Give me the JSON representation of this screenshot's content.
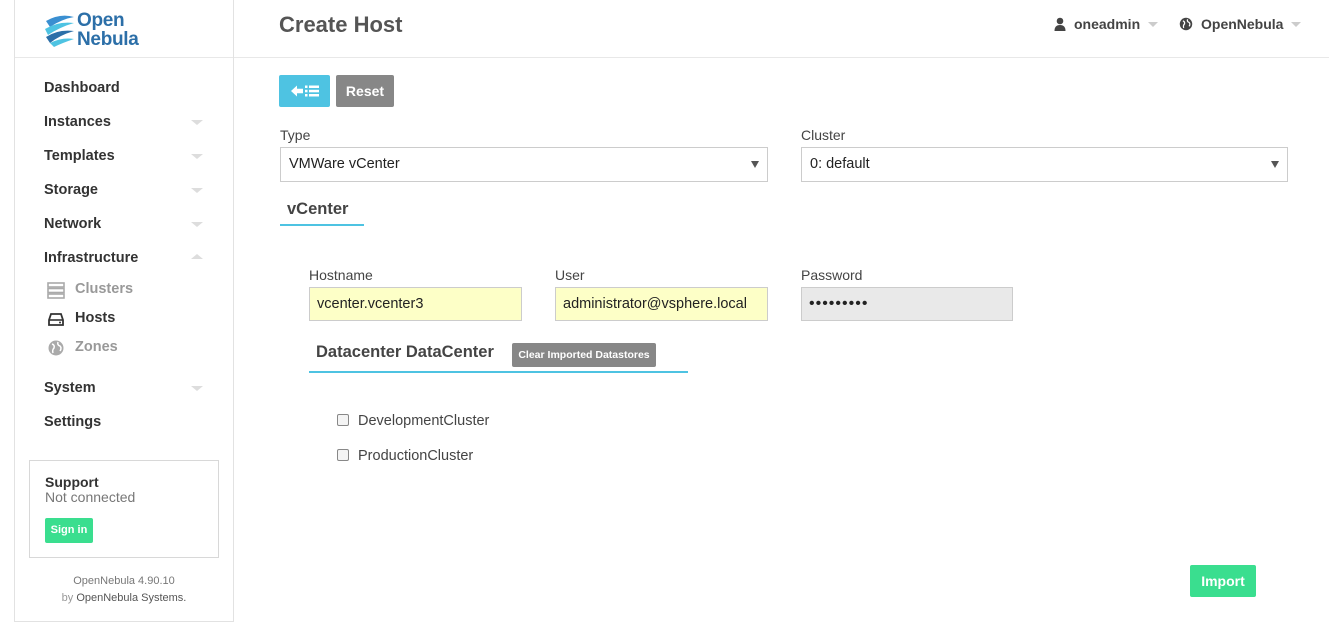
{
  "app": {
    "logo_line1": "Open",
    "logo_line2": "Nebula"
  },
  "sidebar": {
    "items": [
      {
        "label": "Dashboard"
      },
      {
        "label": "Instances"
      },
      {
        "label": "Templates"
      },
      {
        "label": "Storage"
      },
      {
        "label": "Network"
      },
      {
        "label": "Infrastructure"
      },
      {
        "label": "System"
      },
      {
        "label": "Settings"
      }
    ],
    "infrastructure_sub": [
      {
        "label": "Clusters",
        "icon": "server-icon"
      },
      {
        "label": "Hosts",
        "icon": "hdd-icon"
      },
      {
        "label": "Zones",
        "icon": "globe-icon"
      }
    ],
    "support": {
      "title": "Support",
      "status": "Not connected",
      "signin_label": "Sign in"
    },
    "footer": {
      "version": "OpenNebula 4.90.10",
      "by": "by",
      "company": "OpenNebula Systems."
    }
  },
  "header": {
    "title": "Create Host",
    "user": "oneadmin",
    "zone": "OpenNebula"
  },
  "toolbar": {
    "reset_label": "Reset"
  },
  "form": {
    "type_label": "Type",
    "type_value": "VMWare vCenter",
    "cluster_label": "Cluster",
    "cluster_value": "0: default",
    "section_title": "vCenter",
    "hostname_label": "Hostname",
    "hostname_value": "vcenter.vcenter3",
    "user_label": "User",
    "user_value": "administrator@vsphere.local",
    "password_label": "Password",
    "password_value": "•••••••••"
  },
  "datacenter": {
    "title": "Datacenter DataCenter",
    "clear_label": "Clear Imported Datastores",
    "clusters": [
      {
        "label": "DevelopmentCluster",
        "checked": false
      },
      {
        "label": "ProductionCluster",
        "checked": false
      }
    ]
  },
  "actions": {
    "import_label": "Import"
  },
  "colors": {
    "accent": "#4ec3e2",
    "success": "#3ade8f",
    "neutral_button": "#878787",
    "autofill_bg": "#fdffc7"
  }
}
